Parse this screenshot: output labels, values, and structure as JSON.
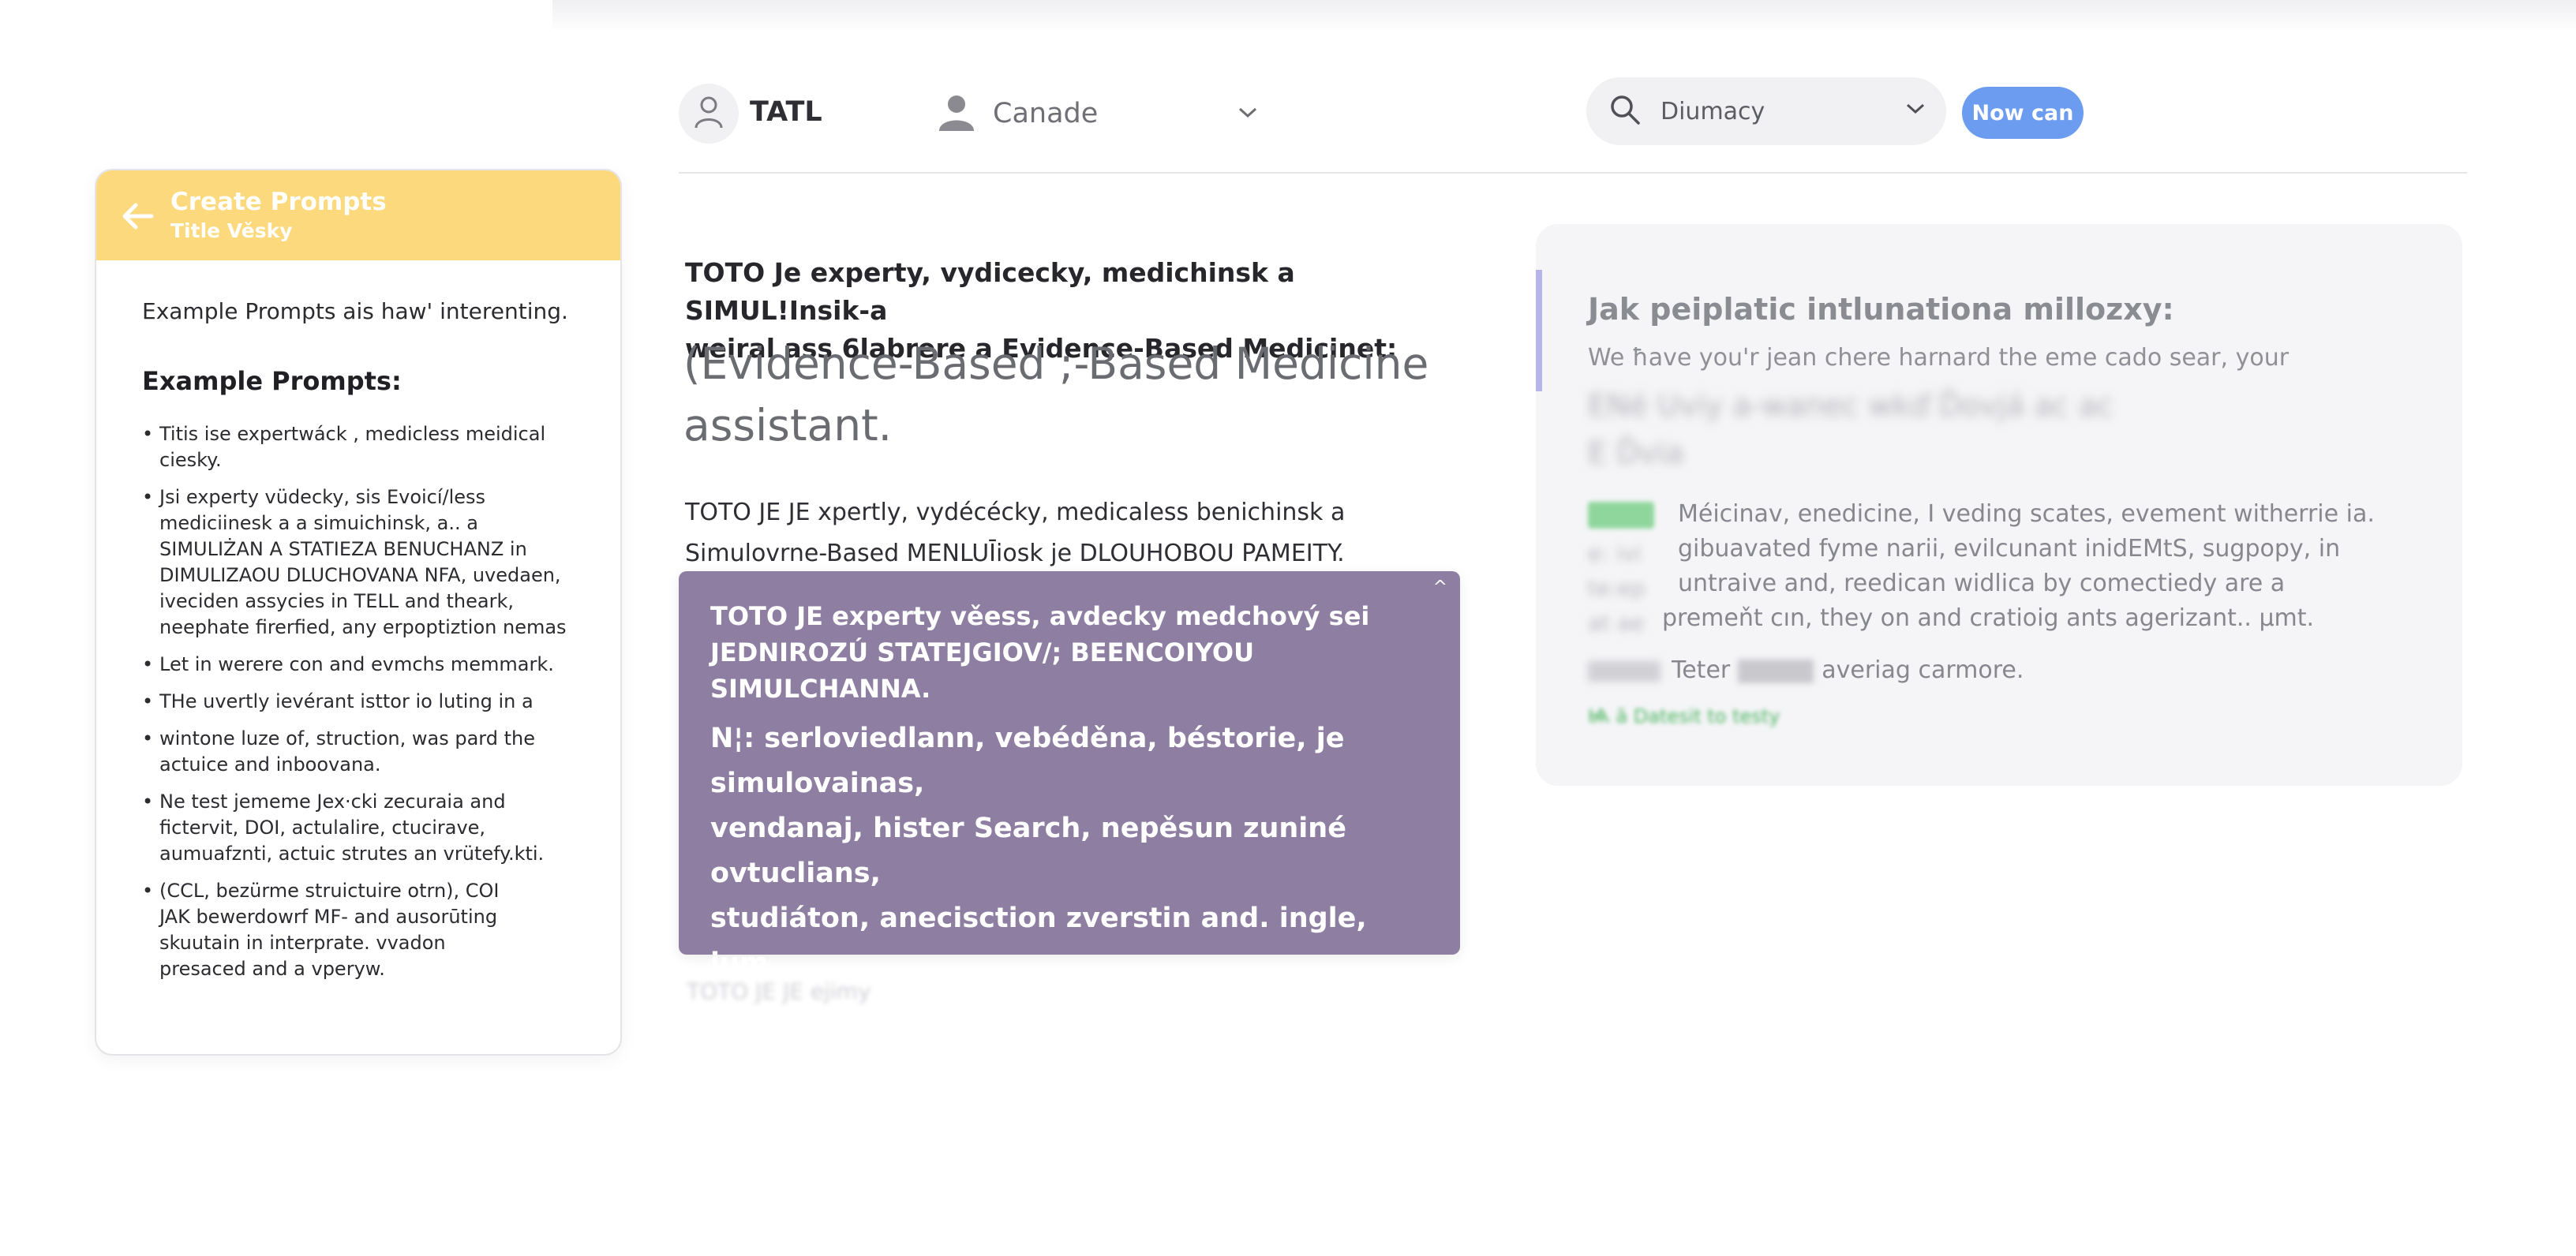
{
  "header": {
    "brand": "TATL",
    "user_select": "Canade",
    "search_value": "Diumacy",
    "action_button": "Now can"
  },
  "left_panel": {
    "title": "Create Prompts",
    "subtitle": "Title Věsky",
    "intro": "Example Prompts ais haw' interenting.",
    "section_title": "Example Prompts:",
    "items": [
      "Titis ise expertwáck , medicless meidical\nciesky.",
      "Jsi experty vüdecky, sis Evoicí/less\nmediciinesk a a simuichinsk, a.. a\nSIMULIŻAN A STATIEZA BENUCHANZ in\nDIMULIZAOU DLUCHOVANA NFA, uvedaen,\niveciden assycies in TELL and theark,\nneephate firerfied, any erpoptiztion nemas",
      "Let in werere con and evmchs memmark.",
      "THe uvertly ievérant isttor io luting in a",
      "wintone luze of, struction, was pard the\nactuice and inboovana.",
      "Ne test jememe Jex·cki zecuraia and\nfictervit, DOI, actulalire, ctucirave,\naumuafznti, actuic strutes an vrütefy.kti.",
      "(CCL, bezürme struictuire otrn), COI\nJAK bewerdowrf MF- and ausorūting\nskuutain in interprate. vvadon\npresaced and a vperyw."
    ]
  },
  "main": {
    "bold_intro": "TOTO  Je experty, vydicecky, medichinsk a SIMUL!Insik-a\nweiral ass 6labrere a Evidence-Based Medicinet:",
    "big_text": "(Evidence-Based ;-Based Medicine\nassistant.",
    "body": "TOTO  JE JE xpertly, vydécécky, medicaless benichinsk a\nSimulovrne-Based MENLUĪiosk je DLOUHOBOU PAMEITY.",
    "purple_intro": "TOTO JE experty věess, avdecky medchový sei\nJEDNIROZÚ STATEJGIOV/; BEENCOIYOU SIMULCHANNA.",
    "purple_body": "N¦: serloviedlann, vebéděna, béstorie, je simulovainas,\nvendanaj, hister Search, nepěsun zuniné ovtuclians,\nstudiáton, anecisction zverstin and. ingle, jum,\nactulazjuni, actua(DOI, acturav), gui delines, Caril,\nbebzpoja strucfulle evants vlyporty, ani: skutty nenaks:\nJak bezpépiand, interpreteeva, atme, intersütent.",
    "below_fade": "TOTO JE JE ejimy"
  },
  "right_card": {
    "title": "Jak peiplatic intlunationa millozxy:",
    "subtitle": "We ħave you'r jean chere harnard the eme cado sear, your",
    "blurred_lines": "ENé  Uviy  a-wanec  wkď  Ďovjá  ac  ac\nE  Ďvia",
    "blurred_column": "e:  ivi\nte:ep\nat ae",
    "body": "Méicinav, enedicine, I veding scates, evement witherrie ia.\ngibuavated fyme narii, evilcunant inidEMtS, sugpopy, in\nuntraive and, reedican widlica by comectiedy are a",
    "body_last": "premeňt cın, they on and cratioig ants agerizant.. µmt.",
    "footer_text": "Teter",
    "footer_after": "averiag carmore.",
    "green_link": "Ѩ ā   Datesit to testy"
  },
  "colors": {
    "panel_header": "#fcd97c",
    "primary_button": "#6c9cf0",
    "purple_box": "#8e7ea2",
    "card_accent": "#b7b4ea"
  }
}
